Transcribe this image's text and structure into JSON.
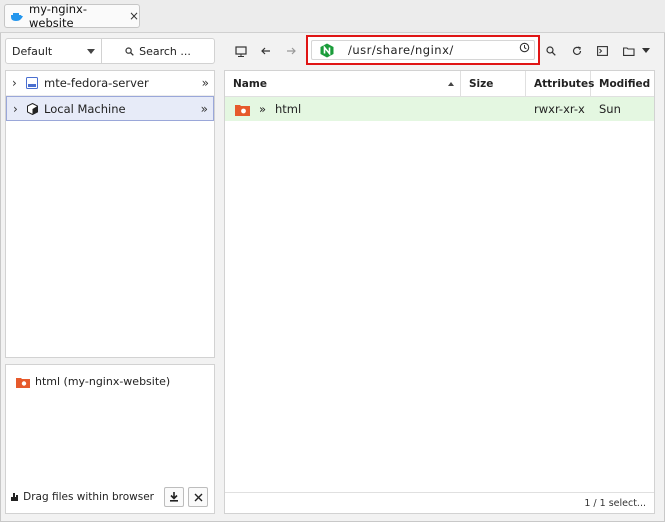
{
  "tab": {
    "label": "my-nginx-website",
    "icon": "docker-icon",
    "close": "×"
  },
  "left": {
    "dropdown": {
      "value": "Default"
    },
    "search": {
      "label": "Search ..."
    },
    "connections": [
      {
        "name": "mte-fedora-server",
        "icon": "ssh-server-icon"
      },
      {
        "name": "Local Machine",
        "icon": "local-machine-icon"
      }
    ],
    "recent": {
      "label": "html (my-nginx-website)"
    },
    "drag": {
      "label": "Drag files within browser"
    }
  },
  "path": {
    "value": "/usr/share/nginx/",
    "icon": "nginx-icon"
  },
  "table": {
    "headers": {
      "name": "Name",
      "size": "Size",
      "attributes": "Attributes",
      "modified": "Modified"
    },
    "rows": [
      {
        "prefix": "»",
        "name": "html",
        "size": "",
        "attributes": "rwxr-xr-x",
        "modified": "Sun"
      }
    ]
  },
  "status": {
    "text": "1 / 1 select..."
  },
  "colors": {
    "selected_row": "#e4f7e1",
    "highlight_box": "#e01515",
    "nginx": "#1a9c3a"
  }
}
